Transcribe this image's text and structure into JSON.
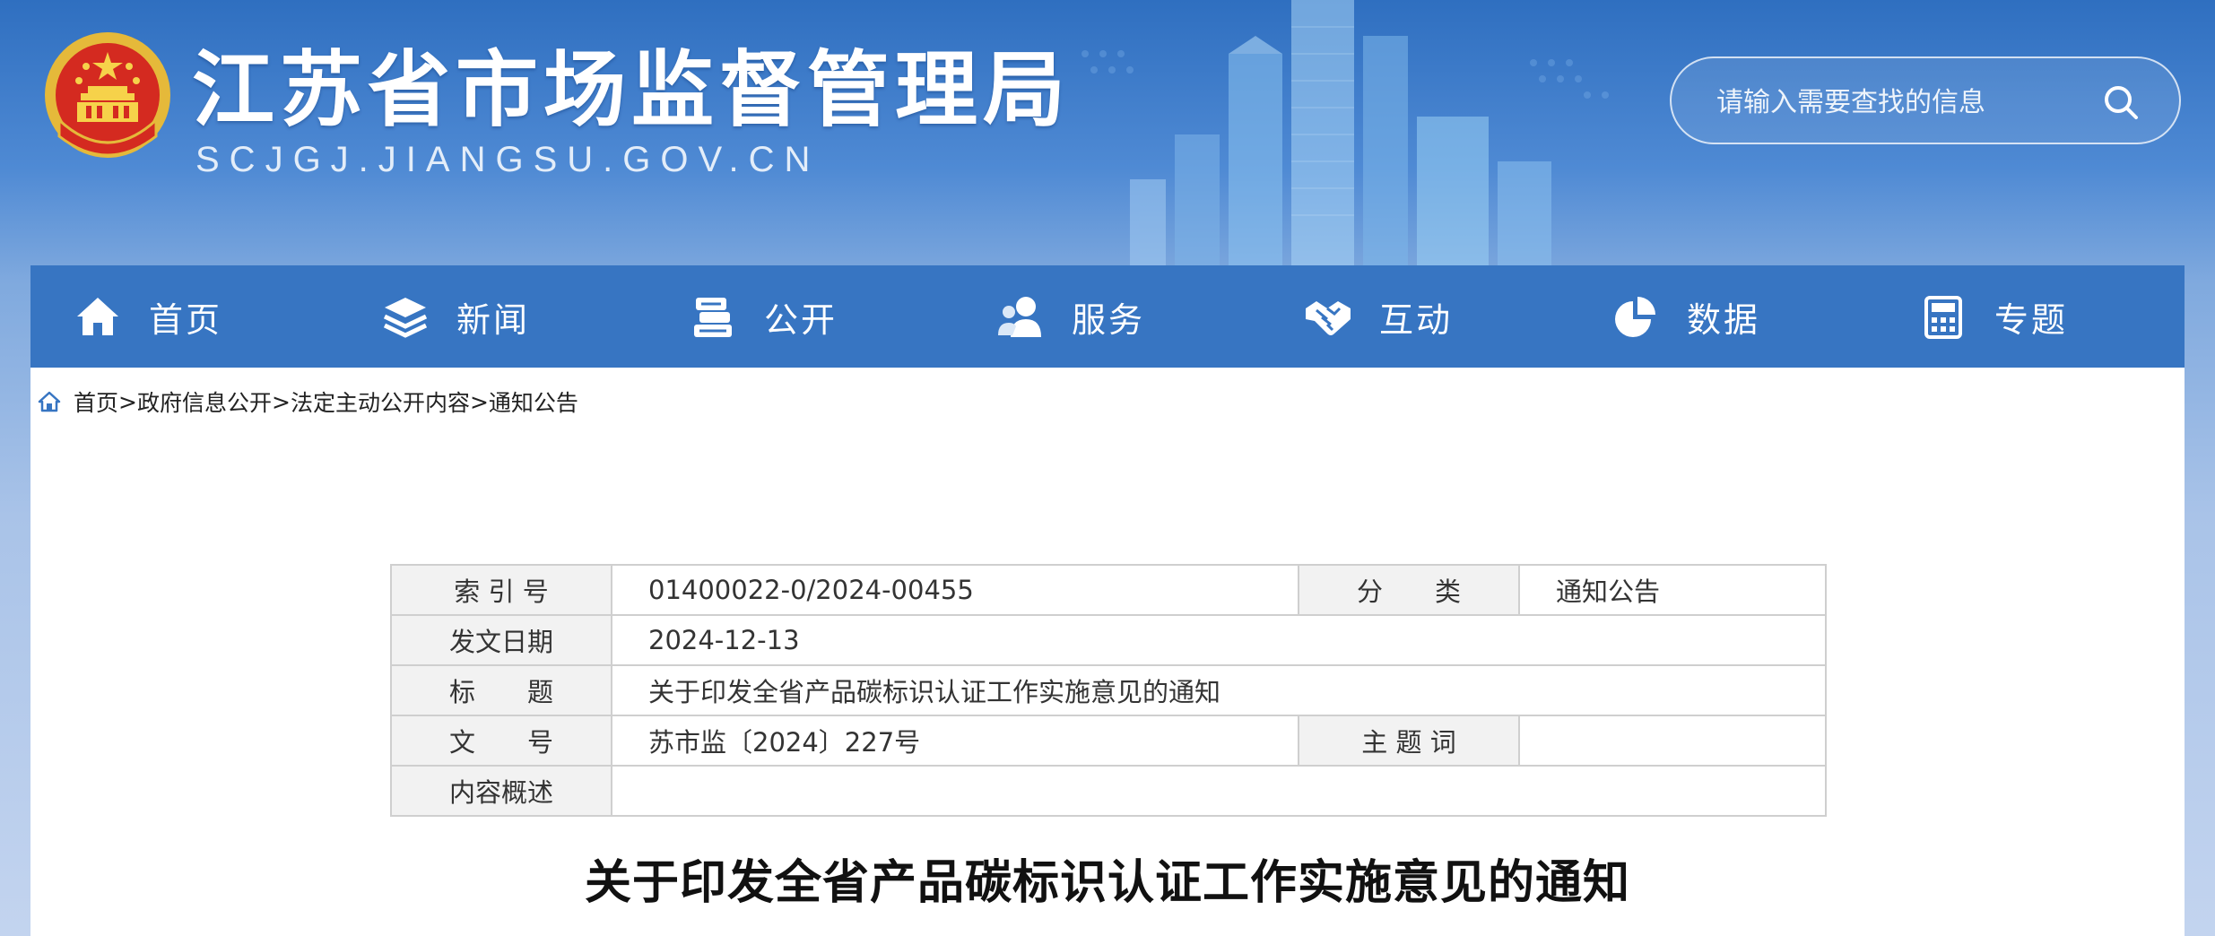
{
  "header": {
    "site_title": "江苏省市场监督管理局",
    "site_domain": "SCJGJ.JIANGSU.GOV.CN",
    "search": {
      "placeholder": "请输入需要查找的信息"
    }
  },
  "nav": {
    "items": [
      {
        "label": "首页",
        "icon": "home-icon"
      },
      {
        "label": "新闻",
        "icon": "layers-icon"
      },
      {
        "label": "公开",
        "icon": "document-stack-icon"
      },
      {
        "label": "服务",
        "icon": "users-icon"
      },
      {
        "label": "互动",
        "icon": "handshake-icon"
      },
      {
        "label": "数据",
        "icon": "pie-chart-icon"
      },
      {
        "label": "专题",
        "icon": "calculator-icon"
      }
    ]
  },
  "breadcrumb": {
    "items": [
      "首页",
      "政府信息公开",
      "法定主动公开内容",
      "通知公告"
    ],
    "separator": ">"
  },
  "meta": {
    "index_label": "索 引 号",
    "index_value": "01400022-0/2024-00455",
    "category_label": "分　　类",
    "category_value": "通知公告",
    "date_label": "发文日期",
    "date_value": "2024-12-13",
    "title_label": "标　　题",
    "title_value": "关于印发全省产品碳标识认证工作实施意见的通知",
    "docno_label": "文　　号",
    "docno_value": "苏市监〔2024〕227号",
    "keyword_label": "主 题 词",
    "keyword_value": "",
    "summary_label": "内容概述",
    "summary_value": ""
  },
  "article": {
    "title": "关于印发全省产品碳标识认证工作实施意见的通知"
  },
  "colors": {
    "nav_bg": "#3775c2",
    "header_bg": "#2f6fc0",
    "label_bg": "#f2f2f2",
    "border": "#cfcfcf"
  }
}
